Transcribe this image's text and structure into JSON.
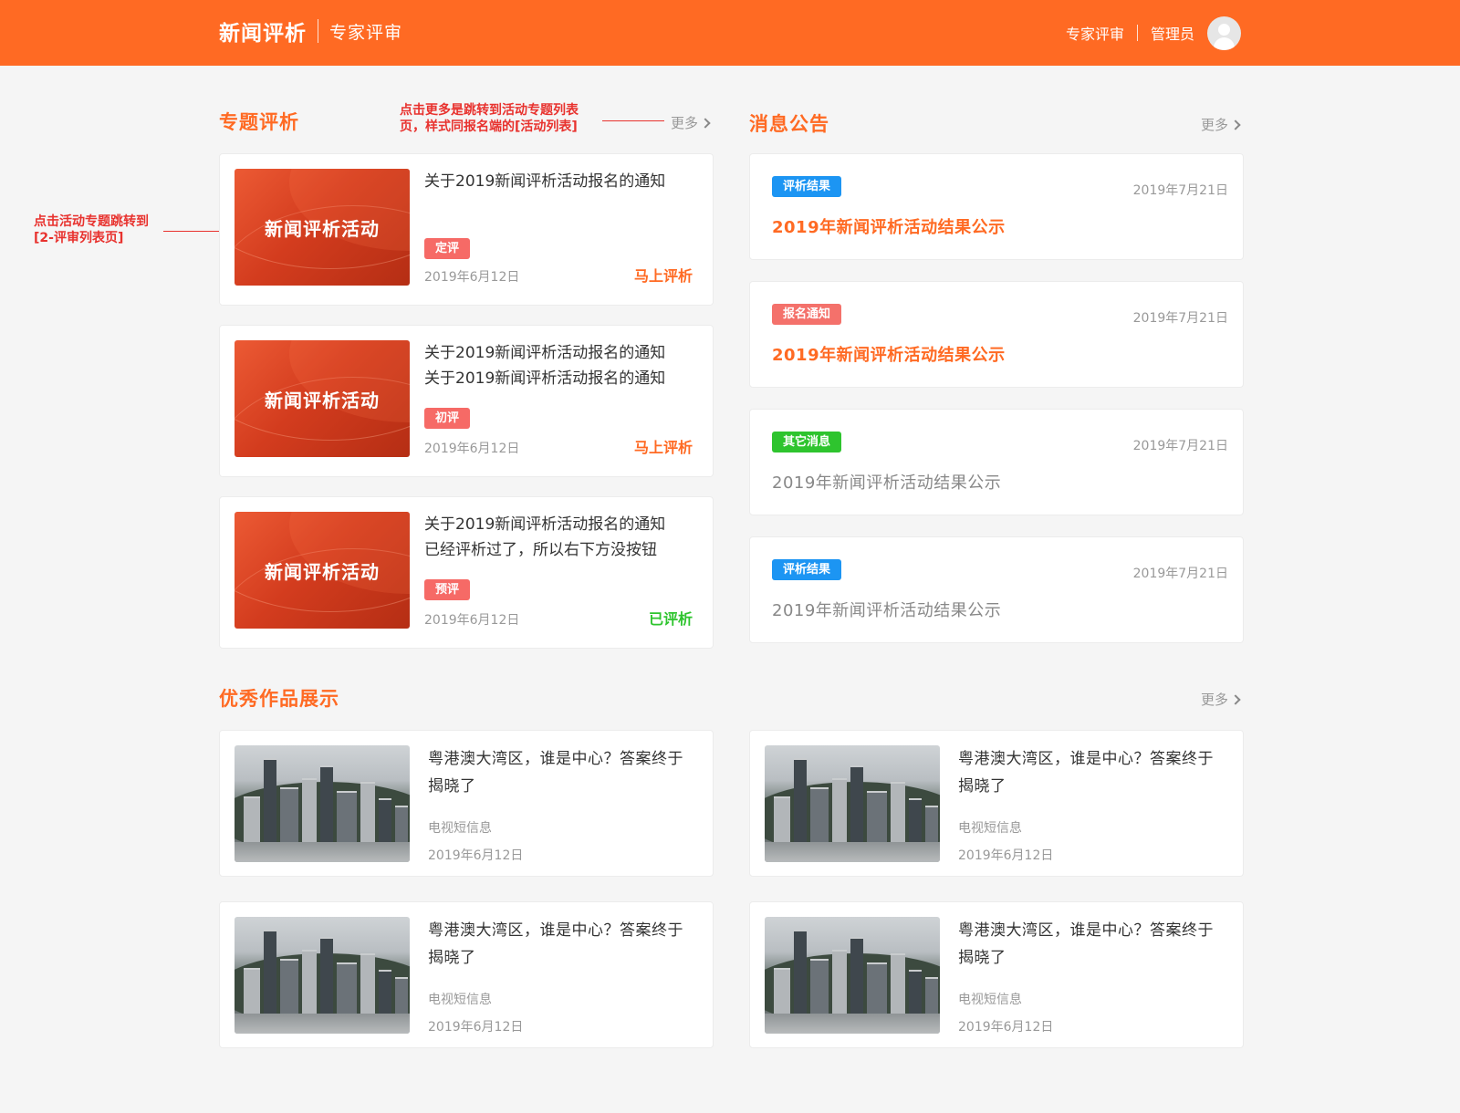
{
  "header": {
    "title": "新闻评析",
    "subtitle": "专家评审",
    "nav_link": "专家评审",
    "user": "管理员"
  },
  "colors": {
    "brand": "#ff6a23",
    "tag_red": "#f66a66",
    "tag_blue": "#1c95f3",
    "tag_green": "#2ec42e",
    "annotation": "#e8322e"
  },
  "topics": {
    "title": "专题评析",
    "more": "更多",
    "annotation": "点击更多是跳转到活动专题列表页，样式同报名端的[活动列表]",
    "annotation_l1": "点击更多是跳转到活动专题列表",
    "annotation_l2": "页，样式同报名端的[活动列表]",
    "card_annotation_l1": "点击活动专题跳转到",
    "card_annotation_l2": "[2-评审列表页]",
    "items": [
      {
        "banner": "新闻评析活动",
        "line1": "关于2019新闻评析活动报名的通知",
        "line2": "",
        "tag": "定评",
        "date": "2019年6月12日",
        "action": "马上评析"
      },
      {
        "banner": "新闻评析活动",
        "line1": "关于2019新闻评析活动报名的通知",
        "line2": "关于2019新闻评析活动报名的通知",
        "tag": "初评",
        "date": "2019年6月12日",
        "action": "马上评析"
      },
      {
        "banner": "新闻评析活动",
        "line1": "关于2019新闻评析活动报名的通知",
        "line2": "已经评析过了，所以右下方没按钮",
        "tag": "预评",
        "date": "2019年6月12日",
        "action": "已评析"
      }
    ]
  },
  "notices": {
    "title": "消息公告",
    "more": "更多",
    "items": [
      {
        "tag": "评析结果",
        "date": "2019年7月21日",
        "title": "2019年新闻评析活动结果公示"
      },
      {
        "tag": "报名通知",
        "date": "2019年7月21日",
        "title": "2019年新闻评析活动结果公示"
      },
      {
        "tag": "其它消息",
        "date": "2019年7月21日",
        "title": "2019年新闻评析活动结果公示"
      },
      {
        "tag": "评析结果",
        "date": "2019年7月21日",
        "title": "2019年新闻评析活动结果公示"
      }
    ]
  },
  "works": {
    "title": "优秀作品展示",
    "more": "更多",
    "items": [
      {
        "title_l1": "粤港澳大湾区，谁是中心？答案终于",
        "title_l2": "揭晓了",
        "source": "电视短信息",
        "date": "2019年6月12日"
      },
      {
        "title_l1": "粤港澳大湾区，谁是中心？答案终于",
        "title_l2": "揭晓了",
        "source": "电视短信息",
        "date": "2019年6月12日"
      },
      {
        "title_l1": "粤港澳大湾区，谁是中心？答案终于",
        "title_l2": "揭晓了",
        "source": "电视短信息",
        "date": "2019年6月12日"
      },
      {
        "title_l1": "粤港澳大湾区，谁是中心？答案终于",
        "title_l2": "揭晓了",
        "source": "电视短信息",
        "date": "2019年6月12日"
      }
    ]
  }
}
